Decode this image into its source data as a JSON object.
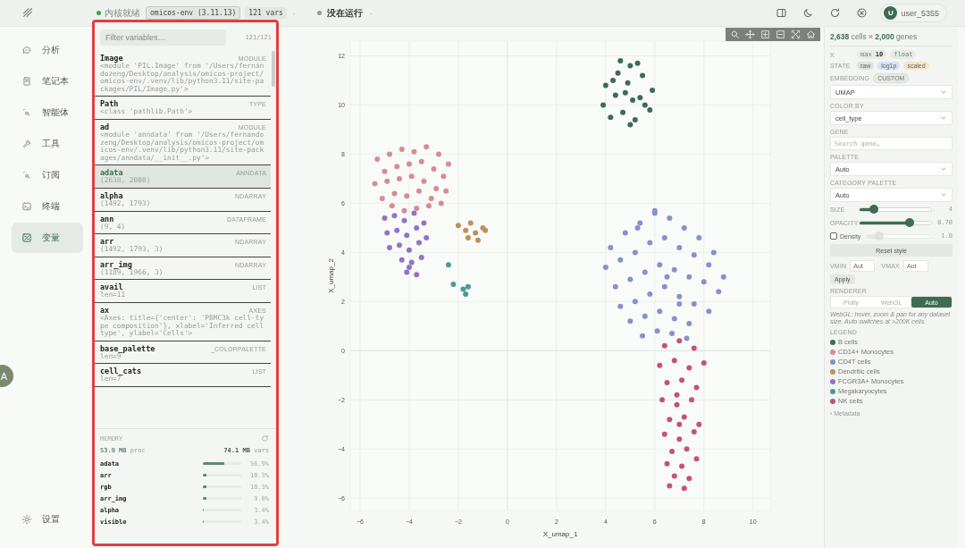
{
  "topbar": {
    "kernel": {
      "status": "内核就绪",
      "ready": true
    },
    "env": "omicos-env (3.11.13)",
    "vars_count": "121 vars",
    "separators": [
      "·",
      "·"
    ],
    "run": {
      "status": "没在运行",
      "running": false
    },
    "user": {
      "initial": "U",
      "name": "user_5355"
    }
  },
  "nav": {
    "items": [
      {
        "label": "分析",
        "selected": false
      },
      {
        "label": "笔记本",
        "selected": false
      },
      {
        "label": "智能体",
        "selected": false
      },
      {
        "label": "工具",
        "selected": false
      },
      {
        "label": "订阅",
        "selected": false
      },
      {
        "label": "终端",
        "selected": false
      },
      {
        "label": "变量",
        "selected": true
      }
    ],
    "footer": "设置"
  },
  "floating_avatar": "A",
  "variables": {
    "filter_placeholder": "Filter variables…",
    "count": "121/121",
    "items": [
      {
        "name": "Image",
        "type": "MODULE",
        "detail": "<module 'PIL.Image' from '/Users/fernandozeng/Desktop/analysis/omicos-project/omicos-env/.venv/lib/python3.11/site-packages/PIL/Image.py'>",
        "selected": false
      },
      {
        "name": "Path",
        "type": "TYPE",
        "detail": "<class 'pathlib.Path'>",
        "selected": false
      },
      {
        "name": "ad",
        "type": "MODULE",
        "detail": "<module 'anndata' from '/Users/fernandozeng/Desktop/analysis/omicos-project/omicos-env/.venv/lib/python3.11/site-packages/anndata/__init__.py'>",
        "selected": false
      },
      {
        "name": "adata",
        "type": "ANNDATA",
        "detail": "(2638, 2000)",
        "selected": true
      },
      {
        "name": "alpha",
        "type": "NDARRAY",
        "detail": "(1492, 1793)",
        "selected": false
      },
      {
        "name": "ann",
        "type": "DATAFRAME",
        "detail": "(9, 4)",
        "selected": false
      },
      {
        "name": "arr",
        "type": "NDARRAY",
        "detail": "(1492, 1793, 3)",
        "selected": false
      },
      {
        "name": "arr_img",
        "type": "NDARRAY",
        "detail": "(1189, 1966, 3)",
        "selected": false
      },
      {
        "name": "avail",
        "type": "LIST",
        "detail": "len=11",
        "selected": false
      },
      {
        "name": "ax",
        "type": "AXES",
        "detail": "<Axes: title={'center': 'PBMC3k cell-type composition'}, xlabel='Inferred cell type', ylabel='Cells'>",
        "selected": false
      },
      {
        "name": "base_palette",
        "type": "_COLORPALETTE",
        "detail": "len=9",
        "selected": false
      },
      {
        "name": "cell_cats",
        "type": "LIST",
        "detail": "len=7",
        "selected": false
      }
    ],
    "memory": {
      "title": "MEMORY",
      "proc_value": "53.9 MB",
      "proc_label": "proc",
      "vars_value": "74.1 MB",
      "vars_label": "vars",
      "rows": [
        {
          "name": "adata",
          "level": 0.569,
          "percent": "56.9%"
        },
        {
          "name": "arr",
          "level": 0.103,
          "percent": "10.3%"
        },
        {
          "name": "rgb",
          "level": 0.103,
          "percent": "10.3%"
        },
        {
          "name": "arr_img",
          "level": 0.09,
          "percent": "9.0%"
        },
        {
          "name": "alpha",
          "level": 0.034,
          "percent": "3.4%"
        },
        {
          "name": "visible",
          "level": 0.034,
          "percent": "3.4%"
        }
      ]
    }
  },
  "plot": {
    "chart_data": {
      "type": "scatter",
      "grid": true,
      "xlabel": "X_umap_1",
      "ylabel": "X_umap_2",
      "xlim": [
        -6.4,
        10.7
      ],
      "ylim": [
        -6.5,
        12.6
      ],
      "xticks": [
        -6,
        -4,
        -2,
        0,
        2,
        4,
        6,
        8,
        10
      ],
      "yticks": [
        -6,
        -4,
        -2,
        0,
        2,
        4,
        6,
        8,
        10,
        12
      ],
      "series": [
        {
          "name": "B cells",
          "color": "#3d6b55",
          "x": [
            4.0,
            4.5,
            5.0,
            5.5,
            5.9,
            3.9,
            4.4,
            4.9,
            5.4,
            5.8,
            4.2,
            4.7,
            5.2,
            5.6,
            4.6,
            5.1,
            4.3,
            5.3,
            4.8,
            5.0
          ],
          "values": [
            10.8,
            11.3,
            11.6,
            11.2,
            10.6,
            10.0,
            10.4,
            10.9,
            10.3,
            9.8,
            9.5,
            9.7,
            9.4,
            10.0,
            11.8,
            10.2,
            11.0,
            11.7,
            10.5,
            9.2
          ]
        },
        {
          "name": "CD14+ Monocytes",
          "color": "#d98b95",
          "x": [
            -5.3,
            -4.8,
            -4.3,
            -3.8,
            -3.3,
            -2.8,
            -2.4,
            -5.0,
            -4.5,
            -4.0,
            -3.5,
            -3.0,
            -2.6,
            -5.4,
            -4.9,
            -4.4,
            -3.9,
            -3.4,
            -2.9,
            -4.6,
            -4.1,
            -3.6,
            -3.1,
            -2.5,
            -5.1,
            -3.7,
            -4.2,
            -3.2,
            -2.7,
            -4.7
          ],
          "values": [
            7.8,
            8.0,
            8.2,
            8.1,
            8.3,
            8.0,
            7.6,
            7.3,
            7.5,
            7.6,
            7.7,
            7.4,
            7.1,
            6.8,
            6.9,
            7.0,
            7.1,
            6.9,
            6.6,
            6.4,
            6.3,
            6.5,
            6.2,
            6.5,
            6.2,
            5.8,
            5.7,
            5.9,
            6.0,
            5.9
          ]
        },
        {
          "name": "CD4T cells",
          "color": "#8a8fd0",
          "x": [
            4.2,
            4.8,
            5.4,
            6.0,
            6.6,
            7.2,
            7.8,
            8.4,
            4.0,
            4.6,
            5.2,
            5.8,
            6.4,
            7.0,
            7.6,
            8.2,
            8.8,
            4.4,
            5.0,
            5.6,
            6.2,
            6.8,
            7.4,
            8.0,
            8.6,
            4.6,
            5.2,
            5.8,
            6.4,
            7.0,
            7.6,
            8.2,
            5.0,
            5.6,
            6.2,
            6.8,
            7.4,
            5.5,
            6.1,
            6.7,
            7.3,
            5.3,
            6.0,
            6.5,
            7.0
          ],
          "values": [
            4.2,
            4.8,
            5.2,
            5.6,
            5.4,
            5.0,
            4.6,
            4.0,
            3.4,
            3.7,
            4.0,
            4.4,
            4.6,
            4.2,
            3.9,
            3.5,
            3.0,
            2.6,
            2.9,
            3.2,
            3.5,
            3.3,
            3.0,
            2.8,
            2.4,
            1.8,
            2.0,
            2.3,
            2.6,
            2.2,
            1.9,
            1.6,
            1.2,
            1.4,
            1.6,
            1.3,
            1.1,
            0.6,
            0.8,
            0.7,
            0.5,
            5.0,
            5.7,
            3.0,
            1.9
          ]
        },
        {
          "name": "Dendritic cells",
          "color": "#c08f5a",
          "x": [
            -2.0,
            -1.7,
            -1.5,
            -1.3,
            -1.0,
            -1.6,
            -1.2,
            -0.9
          ],
          "values": [
            5.1,
            4.9,
            5.2,
            4.8,
            5.0,
            4.6,
            4.5,
            4.9
          ]
        },
        {
          "name": "FCGR3A+ Monocytes",
          "color": "#9373c8",
          "x": [
            -5.0,
            -4.6,
            -4.2,
            -3.8,
            -3.4,
            -4.9,
            -4.5,
            -4.1,
            -3.7,
            -3.3,
            -4.8,
            -4.4,
            -4.0,
            -3.6,
            -4.3,
            -3.9,
            -3.5,
            -4.1,
            -3.7,
            -4.0
          ],
          "values": [
            5.4,
            5.5,
            5.3,
            5.6,
            5.2,
            4.8,
            4.9,
            4.7,
            5.0,
            4.6,
            4.2,
            4.3,
            4.1,
            4.4,
            3.7,
            3.6,
            3.8,
            3.2,
            3.1,
            3.4
          ]
        },
        {
          "name": "Megakaryocytes",
          "color": "#4a9a94",
          "x": [
            -2.2,
            -1.8,
            -2.4,
            -1.7,
            -1.6
          ],
          "values": [
            2.7,
            2.5,
            3.5,
            2.3,
            2.6
          ]
        },
        {
          "name": "NK cells",
          "color": "#c4537a",
          "x": [
            6.4,
            7.0,
            7.6,
            6.2,
            6.8,
            7.4,
            8.0,
            6.5,
            7.1,
            7.7,
            6.3,
            6.9,
            7.5,
            6.6,
            7.2,
            7.8,
            6.4,
            7.0,
            7.6,
            6.7,
            7.3,
            6.5,
            7.1,
            7.7,
            6.8,
            7.4,
            6.6,
            7.2,
            7.0,
            6.9
          ],
          "values": [
            0.2,
            0.4,
            0.1,
            -0.6,
            -0.4,
            -0.7,
            -0.5,
            -1.3,
            -1.2,
            -1.5,
            -2.0,
            -2.2,
            -2.0,
            -2.8,
            -2.7,
            -3.0,
            -3.4,
            -3.6,
            -3.3,
            -4.1,
            -4.0,
            -4.6,
            -4.7,
            -4.4,
            -5.1,
            -5.2,
            -5.5,
            -5.6,
            -3.0,
            -1.8
          ]
        }
      ]
    }
  },
  "inspector": {
    "summary": "**2,638** cells × **2,000** genes",
    "x_row": {
      "label": "X",
      "chips": [
        "max **10**",
        "float"
      ]
    },
    "state_row": {
      "label": "STATE",
      "chips": [
        {
          "label": "raw",
          "color": "#dde2de"
        },
        {
          "label": "log1p",
          "color": "#d6e3f6"
        },
        {
          "label": "scaled",
          "color": "#f7e5c6"
        }
      ]
    },
    "embedding": {
      "label": "EMBEDDING",
      "tag": "CUSTOM",
      "value": "UMAP"
    },
    "color_by": {
      "label": "COLOR BY",
      "value": "cell_type"
    },
    "gene": {
      "label": "GENE",
      "placeholder": "Search gene…"
    },
    "palette": {
      "label": "PALETTE",
      "value": "Auto"
    },
    "category_palette": {
      "label": "CATEGORY PALETTE",
      "value": "Auto"
    },
    "controls": [
      {
        "kind": "slider",
        "label": "SIZE",
        "level": 0.2,
        "reading": "4"
      },
      {
        "kind": "slider",
        "label": "OPACITY",
        "level": 0.7,
        "reading": "0.70"
      },
      {
        "kind": "checkbox",
        "label": "Density",
        "checked": false,
        "level": 0.2,
        "reading": "1.0"
      }
    ],
    "reset_button": "Reset style",
    "vmin": {
      "label": "VMIN",
      "placeholder": "Aut"
    },
    "vmax": {
      "label": "VMAX",
      "placeholder": "Aut"
    },
    "apply_button": "Apply",
    "renderer": {
      "label": "RENDERER",
      "options": [
        {
          "label": "Plotly",
          "selected": false
        },
        {
          "label": "WebGL",
          "selected": false
        },
        {
          "label": "Auto",
          "selected": true
        }
      ],
      "note": "WebGL: hover, zoom & pan for any dataset size. Auto switches at >200K cells."
    },
    "legend": {
      "label": "LEGEND"
    },
    "metadata": "› Metadata"
  }
}
